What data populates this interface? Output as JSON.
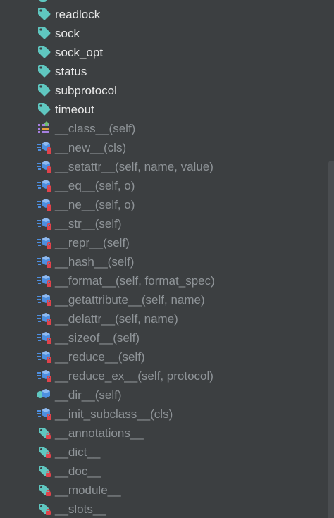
{
  "members": [
    {
      "label": "readlock",
      "kind": "field"
    },
    {
      "label": "sock",
      "kind": "field"
    },
    {
      "label": "sock_opt",
      "kind": "field"
    },
    {
      "label": "status",
      "kind": "field"
    },
    {
      "label": "subprotocol",
      "kind": "field"
    },
    {
      "label": "timeout",
      "kind": "field"
    },
    {
      "label": "__class__(self)",
      "kind": "property"
    },
    {
      "label": "__new__(cls)",
      "kind": "method"
    },
    {
      "label": "__setattr__(self, name, value)",
      "kind": "method"
    },
    {
      "label": "__eq__(self, o)",
      "kind": "method"
    },
    {
      "label": "__ne__(self, o)",
      "kind": "method"
    },
    {
      "label": "__str__(self)",
      "kind": "method"
    },
    {
      "label": "__repr__(self)",
      "kind": "method"
    },
    {
      "label": "__hash__(self)",
      "kind": "method"
    },
    {
      "label": "__format__(self, format_spec)",
      "kind": "method"
    },
    {
      "label": "__getattribute__(self, name)",
      "kind": "method"
    },
    {
      "label": "__delattr__(self, name)",
      "kind": "method"
    },
    {
      "label": "__sizeof__(self)",
      "kind": "method"
    },
    {
      "label": "__reduce__(self)",
      "kind": "method"
    },
    {
      "label": "__reduce_ex__(self, protocol)",
      "kind": "method"
    },
    {
      "label": "__dir__(self)",
      "kind": "method-public"
    },
    {
      "label": "__init_subclass__(cls)",
      "kind": "method"
    },
    {
      "label": "__annotations__",
      "kind": "variable"
    },
    {
      "label": "__dict__",
      "kind": "variable"
    },
    {
      "label": "__doc__",
      "kind": "variable"
    },
    {
      "label": "__module__",
      "kind": "variable"
    },
    {
      "label": "__slots__",
      "kind": "variable"
    }
  ],
  "icons": {
    "field": "tag-field-icon",
    "property": "property-icon",
    "method": "locked-method-icon",
    "method-public": "method-icon",
    "variable": "variable-icon"
  },
  "colors": {
    "background": "#3c3f41",
    "field_text": "#e8e8e8",
    "inherited_text": "#8f9498",
    "tag": "#5fc7c0",
    "method_blue": "#4d8fe0",
    "lock_red": "#e0434b",
    "property_green": "#6fbf73",
    "property_purple": "#a57fe0"
  }
}
